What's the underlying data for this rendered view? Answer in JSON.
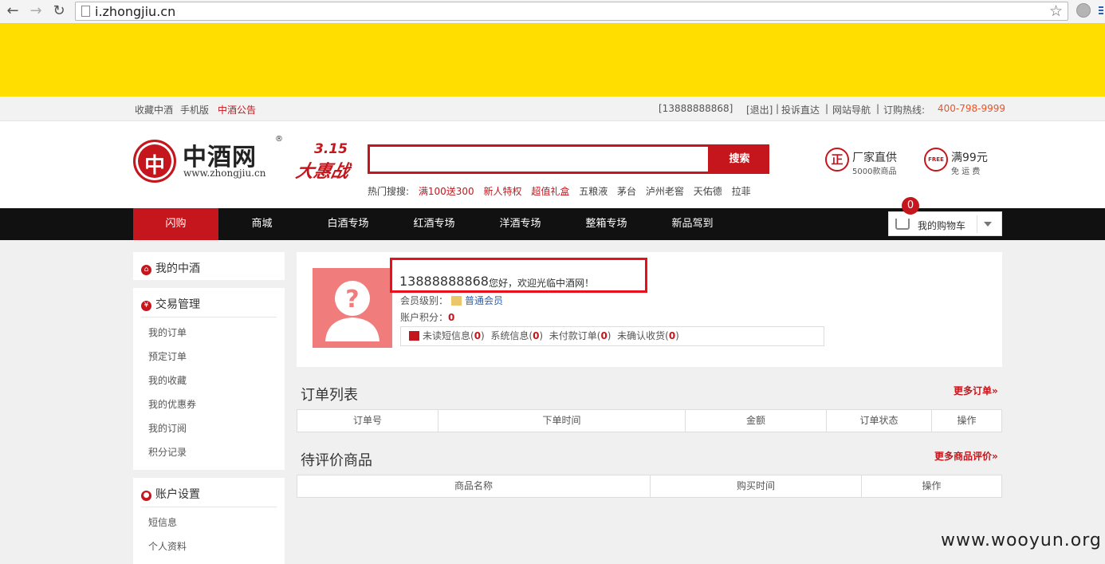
{
  "browser": {
    "url": "i.zhongjiu.cn",
    "back_icon": "arrow-left",
    "forward_icon": "arrow-right",
    "reload_icon": "reload"
  },
  "topbar": {
    "left_links": [
      "收藏中酒",
      "手机版",
      "中酒公告"
    ],
    "user": "[13888888868]",
    "logout": "[退出]",
    "sep1": "|",
    "complaint": "投诉直达",
    "sep2": "|",
    "sitemap": "网站导航",
    "sep3": "|",
    "hotline_label": "订购热线:",
    "hotline": "400-798-9999"
  },
  "header": {
    "logo_mark": "中",
    "logo_name": "中酒网",
    "logo_reg": "®",
    "logo_url": "www.zhongjiu.cn",
    "promo_num": "3.15",
    "promo_text": "大惠战",
    "search_button": "搜索",
    "hot_label": "热门搜搜:",
    "hot_terms": [
      "满100送300",
      "新人特权",
      "超值礼盒",
      "五粮液",
      "茅台",
      "泸州老窖",
      "天佑德",
      "拉菲"
    ],
    "feature1": {
      "mark": "正",
      "title": "厂家直供",
      "sub": "5000款商品"
    },
    "feature2": {
      "mark": "FREE",
      "title": "满99元",
      "sub": "免 运 费"
    }
  },
  "nav": {
    "items": [
      "闪购",
      "商城",
      "白酒专场",
      "红酒专场",
      "洋酒专场",
      "整箱专场",
      "新品驾到"
    ],
    "active_index": 0,
    "cart_label": "我的购物车",
    "cart_count": "0"
  },
  "sidebar": {
    "my_home": "我的中酒",
    "trade_title": "交易管理",
    "trade_items": [
      "我的订单",
      "预定订单",
      "我的收藏",
      "我的优惠券",
      "我的订阅",
      "积分记录"
    ],
    "account_title": "账户设置",
    "account_items": [
      "短信息",
      "个人资料"
    ]
  },
  "user": {
    "name": "13888888868",
    "welcome": "您好，欢迎光临中酒网！",
    "level_label": "会员级别：",
    "level": "普通会员",
    "points_label": "账户积分：",
    "points": "0",
    "msg_unread_label": "未读短信息(",
    "msg_unread": "0",
    "msg_sys_label": "系统信息(",
    "msg_sys": "0",
    "msg_unpaid_label": "未付款订单(",
    "msg_unpaid": "0",
    "msg_unconfirmed_label": "未确认收货(",
    "msg_unconfirmed": "0",
    "close_paren": ")"
  },
  "orders": {
    "title": "订单列表",
    "more": "更多订单»",
    "columns": [
      "订单号",
      "下单时间",
      "金额",
      "订单状态",
      "操作"
    ]
  },
  "reviews": {
    "title": "待评价商品",
    "more": "更多商品评价»",
    "columns": [
      "商品名称",
      "购买时间",
      "操作"
    ]
  },
  "watermark": "www.wooyun.org",
  "colors": {
    "brand_red": "#c4161c",
    "banner_yellow": "#ffde00",
    "nav_black": "#111111"
  }
}
